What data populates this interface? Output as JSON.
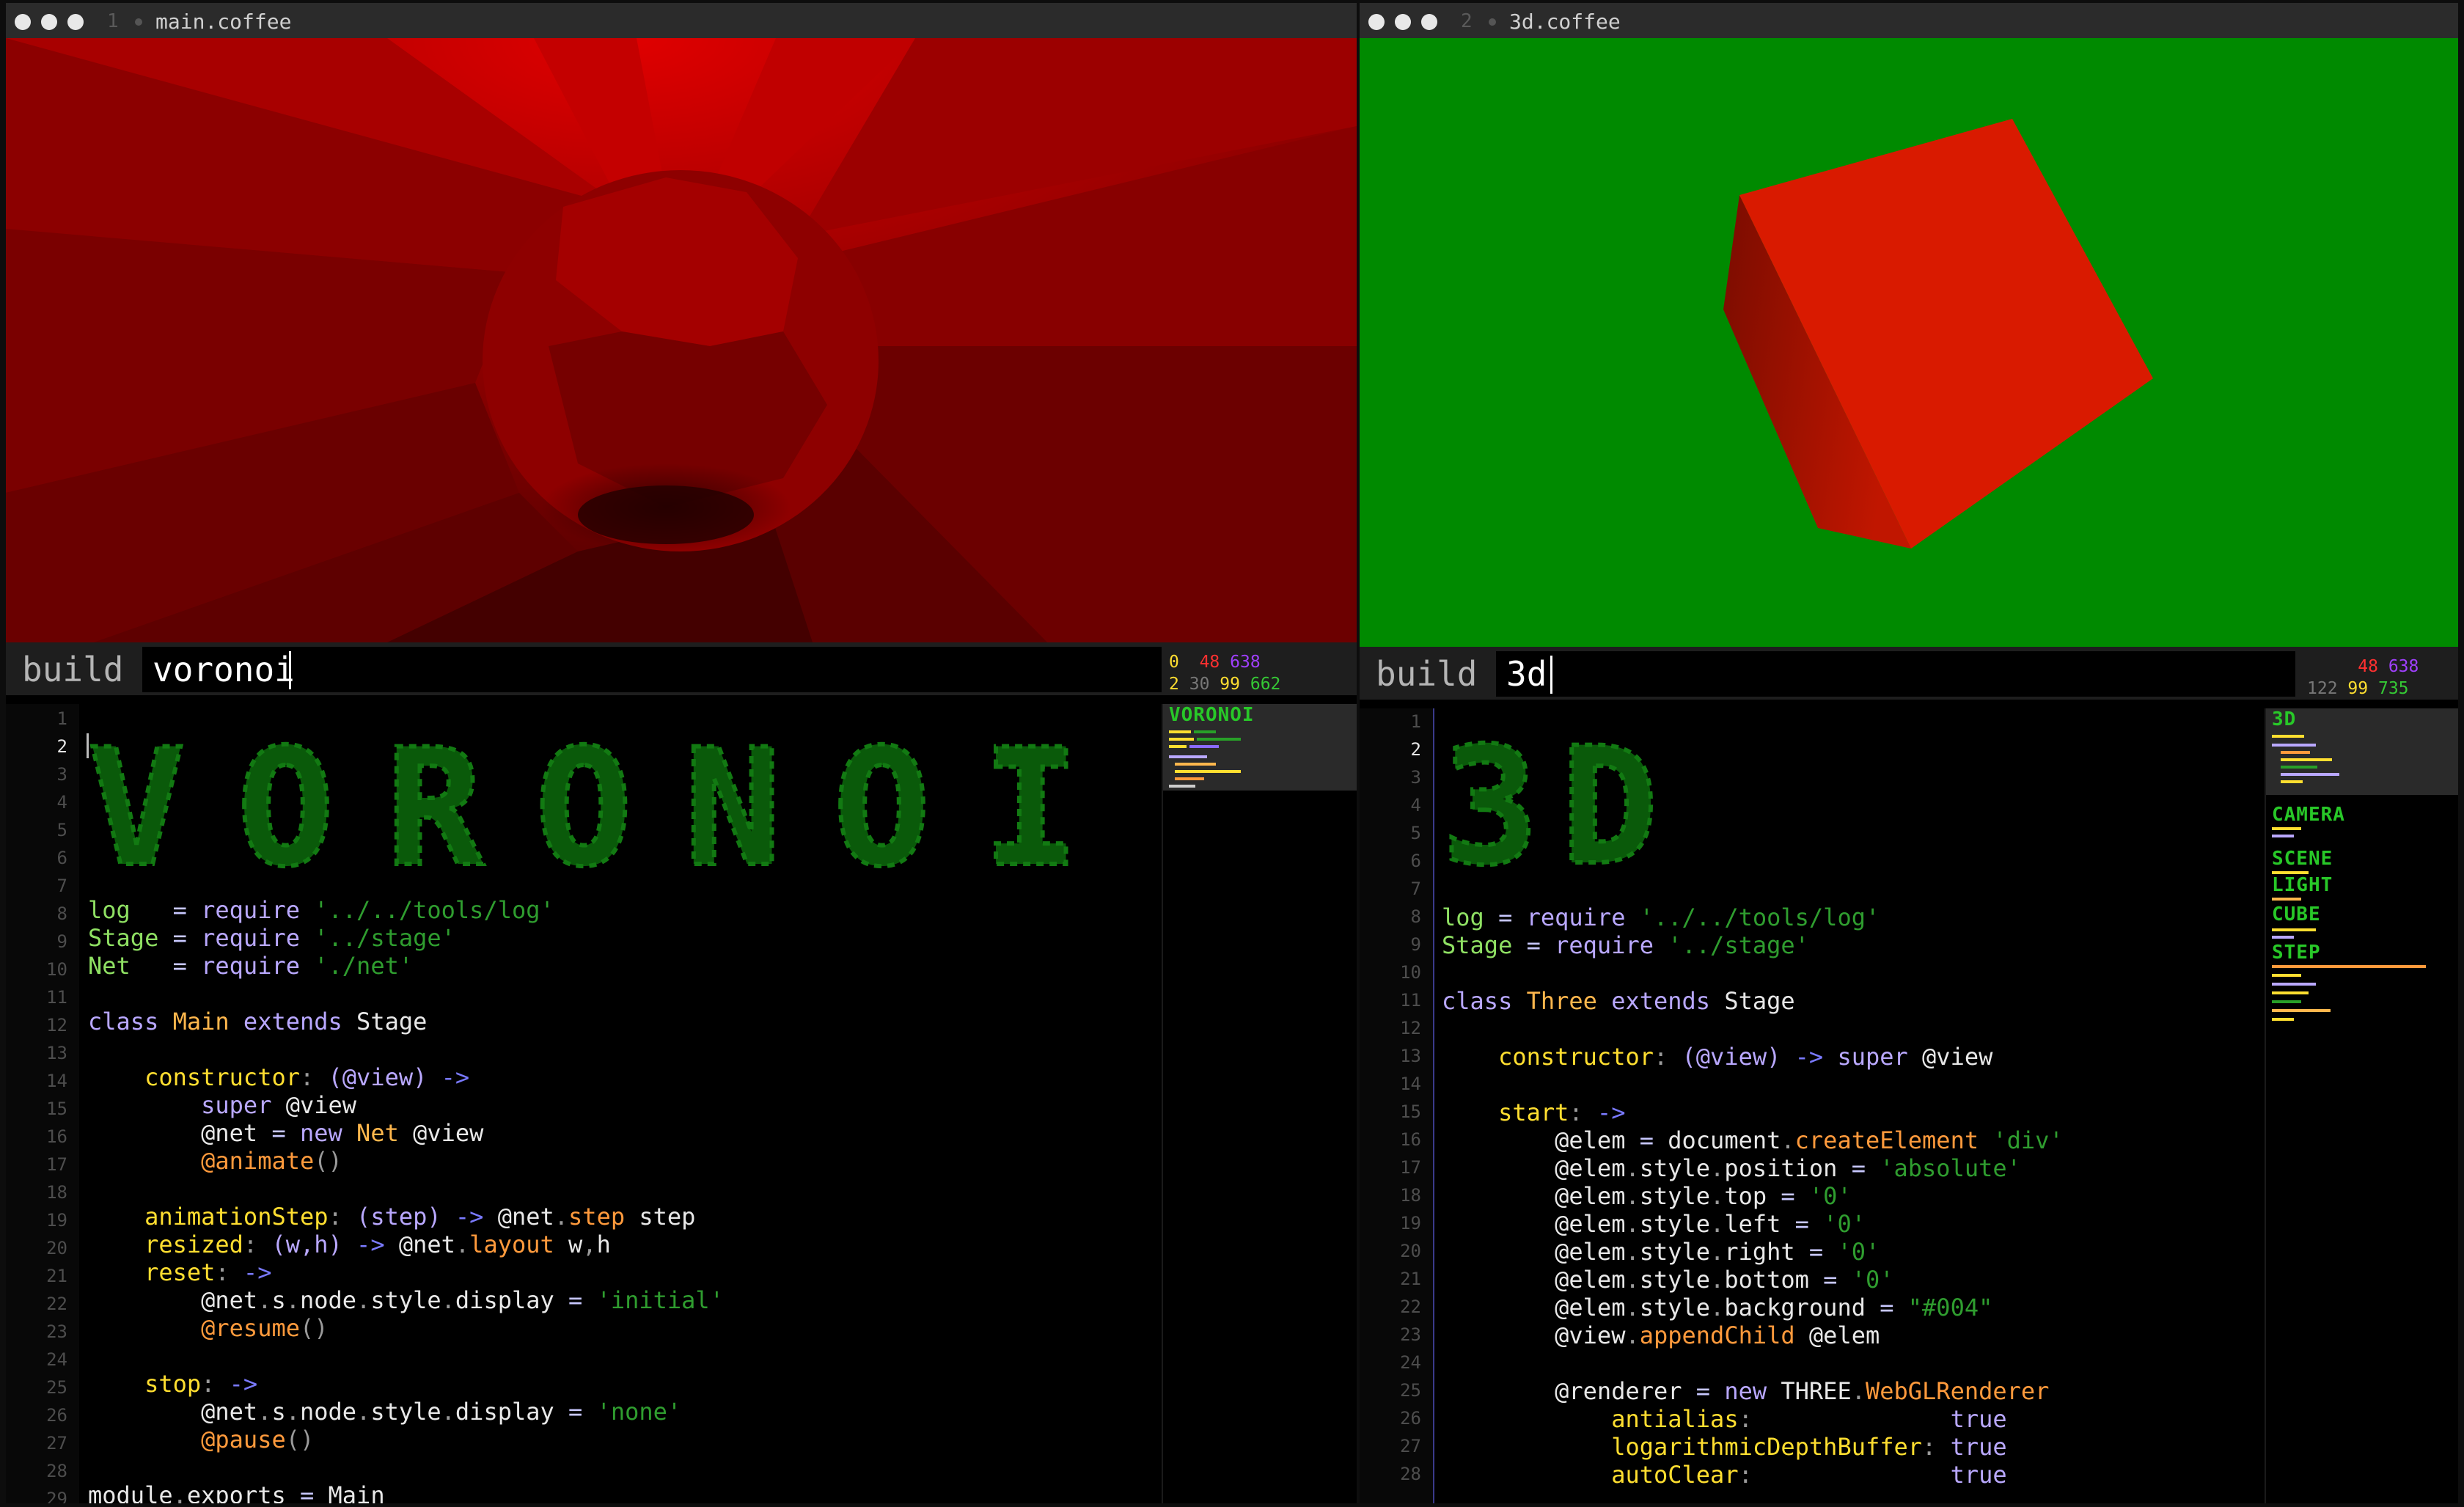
{
  "windows": [
    {
      "index": "1",
      "title": "main.coffee",
      "build_label": "build",
      "build_value": "voronoi",
      "stats_row1": [
        "0",
        "48",
        "638"
      ],
      "stats_row2": [
        "2",
        "30",
        "99",
        "662"
      ],
      "minimap_sections": [
        "VORONOI"
      ],
      "banner_text": "VORONOI",
      "current_line": 2
    },
    {
      "index": "2",
      "title": "3d.coffee",
      "build_label": "build",
      "build_value": "3d",
      "stats_row1": [
        "48",
        "638"
      ],
      "stats_row2": [
        "122",
        "99",
        "735"
      ],
      "minimap_sections": [
        "3D",
        "CAMERA",
        "SCENE",
        "LIGHT",
        "CUBE",
        "STEP"
      ],
      "banner_text": "3D",
      "current_line": 2
    }
  ],
  "colors": {
    "view1_base": "#8a0000",
    "view2_base": "#008a00",
    "cube_face": "#dc1a00",
    "cube_side": "#a11000"
  }
}
